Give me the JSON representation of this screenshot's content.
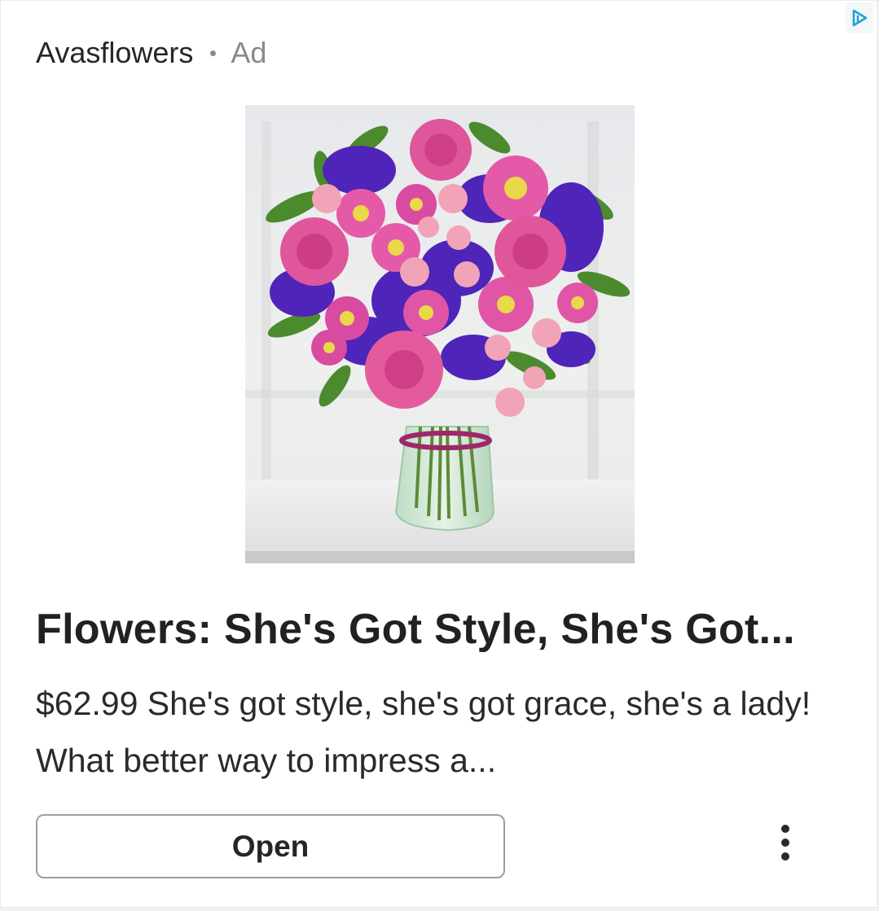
{
  "ad": {
    "advertiser": "Avasflowers",
    "ad_label": "Ad",
    "title": "Flowers: She's Got Style, She's Got...",
    "description": "$62.99 She's got style, she's got grace, she's a lady! What better way to impress a...",
    "cta_label": "Open"
  },
  "icons": {
    "adchoices": "adchoices-icon",
    "more": "more-vertical-icon"
  },
  "colors": {
    "adchoices": "#1fa0d8",
    "text_primary": "#212121",
    "text_secondary": "#8a8a8a",
    "button_border": "#9e9e9e"
  }
}
